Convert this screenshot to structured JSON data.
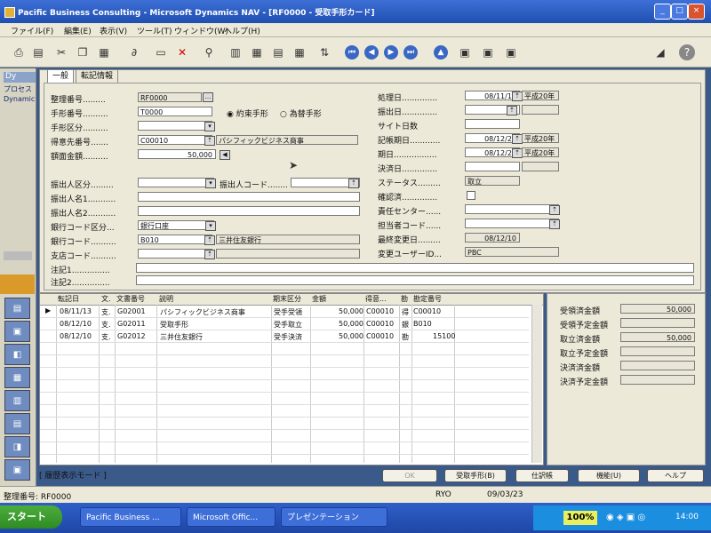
{
  "window": {
    "title": "Pacific Business Consulting - Microsoft Dynamics NAV - [RF0000 - 受取手形カード]"
  },
  "menu": [
    "ファイル(F)",
    "編集(E)",
    "表示(V)",
    "ツール(T)",
    "ウィンドウ(W)",
    "ヘルプ(H)"
  ],
  "leftnav": {
    "title": "Dy",
    "items": [
      "プロセス",
      "Dynamic"
    ]
  },
  "tabs": [
    "一般",
    "転記情報"
  ],
  "form": {
    "left": {
      "rows": [
        {
          "label": "整理番号.........",
          "value": "RF0000"
        },
        {
          "label": "手形番号..........",
          "value": "T0000"
        },
        {
          "label": "手形区分..........",
          "value": ""
        },
        {
          "label": "得意先番号.......",
          "value": "C00010",
          "value2": "パシフィックビジネス商事"
        },
        {
          "label": "額面金額..........",
          "value": "50,000"
        }
      ],
      "radio_promissory": "約束手形",
      "radio_bill": "為替手形",
      "rows2": [
        {
          "label": "振出人区分.........",
          "value": ""
        },
        {
          "label": "振出人名1...........",
          "value": ""
        },
        {
          "label": "振出人名2...........",
          "value": ""
        },
        {
          "label": "銀行コード区分...",
          "value": "銀行口座"
        },
        {
          "label": "銀行コード..........",
          "value": "B010",
          "value2": "三井住友銀行"
        },
        {
          "label": "支店コード..........",
          "value": ""
        },
        {
          "label": "注記1...............",
          "value": ""
        },
        {
          "label": "注記2...............",
          "value": ""
        }
      ],
      "drawer_code_label": "振出人コード........"
    },
    "right": {
      "rows": [
        {
          "label": "処理日..............",
          "value": "08/11/17",
          "era": "平成20年"
        },
        {
          "label": "振出日..............",
          "value": ""
        },
        {
          "label": "サイト日数",
          "value": ""
        },
        {
          "label": "記帳期日............",
          "value": "08/12/20",
          "era": "平成20年"
        },
        {
          "label": "期日.................",
          "value": "08/12/23",
          "era": "平成20年"
        },
        {
          "label": "決済日..............",
          "value": ""
        },
        {
          "label": "ステータス.........",
          "value": "取立"
        },
        {
          "label": "確認済..............",
          "value": ""
        },
        {
          "label": "責任センター......",
          "value": ""
        },
        {
          "label": "担当者コード......",
          "value": ""
        },
        {
          "label": "最終変更日.........",
          "value": "08/12/10"
        },
        {
          "label": "変更ユーザーID...",
          "value": "PBC"
        }
      ]
    }
  },
  "grid": {
    "headers": [
      "転記日",
      "文.",
      "文書番号",
      "説明",
      "期末区分",
      "金額",
      "得意...",
      "勘",
      "勘定番号"
    ],
    "rows": [
      [
        "08/11/13",
        "支.",
        "G02001",
        "パシフィックビジネス商事",
        "受手受領",
        "50,000",
        "C00010",
        "得",
        "C00010"
      ],
      [
        "08/12/10",
        "支.",
        "G02011",
        "受取手形",
        "受手取立",
        "50,000",
        "C00010",
        "銀",
        "B010"
      ],
      [
        "08/12/10",
        "支.",
        "G02012",
        "三井住友銀行",
        "受手決済",
        "50,000",
        "C00010",
        "勘",
        "15100"
      ]
    ]
  },
  "totals": [
    {
      "label": "受領済金額",
      "value": "50,000"
    },
    {
      "label": "受領予定金額",
      "value": ""
    },
    {
      "label": "取立済金額",
      "value": "50,000"
    },
    {
      "label": "取立予定金額",
      "value": ""
    },
    {
      "label": "決済済金額",
      "value": ""
    },
    {
      "label": "決済予定金額",
      "value": ""
    }
  ],
  "mode_text": "[ 履歴表示モード ]",
  "buttons": {
    "ok": "OK",
    "bill": "受取手形(B)",
    "journal": "仕訳帳",
    "function": "機能(U)",
    "help": "ヘルプ"
  },
  "status": {
    "record": "整理番号: RF0000",
    "user": "RYO",
    "date": "09/03/23"
  },
  "taskbar": {
    "start": "スタート",
    "tasks": [
      "Pacific Business ...",
      "Microsoft Offic...",
      "プレゼンテーション"
    ],
    "zoom": "100%",
    "clock": "14:00"
  }
}
